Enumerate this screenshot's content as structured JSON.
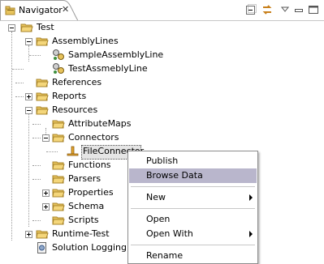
{
  "view": {
    "title": "Navigator",
    "close_glyph": "✕"
  },
  "toolbar": [
    "collapse-all-icon",
    "link-with-editor-icon",
    "view-menu-icon",
    "minimize-icon",
    "maximize-icon"
  ],
  "tree": {
    "root": "Test",
    "assembly_lines": "AssemblyLines",
    "sample_assembly_line": "SampleAssemblyLine",
    "test_assembly_line": "TestAssmeblyLine",
    "references": "References",
    "reports": "Reports",
    "resources": "Resources",
    "attribute_maps": "AttributeMaps",
    "connectors": "Connectors",
    "file_connector": "FileConnector",
    "functions": "Functions",
    "parsers": "Parsers",
    "properties": "Properties",
    "schema": "Schema",
    "scripts": "Scripts",
    "runtime_test": "Runtime-Test",
    "solution_logging": "Solution Logging a"
  },
  "context_menu": {
    "publish": "Publish",
    "browse_data": "Browse Data",
    "new": "New",
    "open": "Open",
    "open_with": "Open With",
    "rename": "Rename",
    "highlight_color": "#b9b6cc"
  },
  "colors": {
    "folder": "#e7c35c",
    "folder_edge": "#a8842a",
    "selection": "#e5e5e5",
    "separator": "#c6c6c6"
  }
}
